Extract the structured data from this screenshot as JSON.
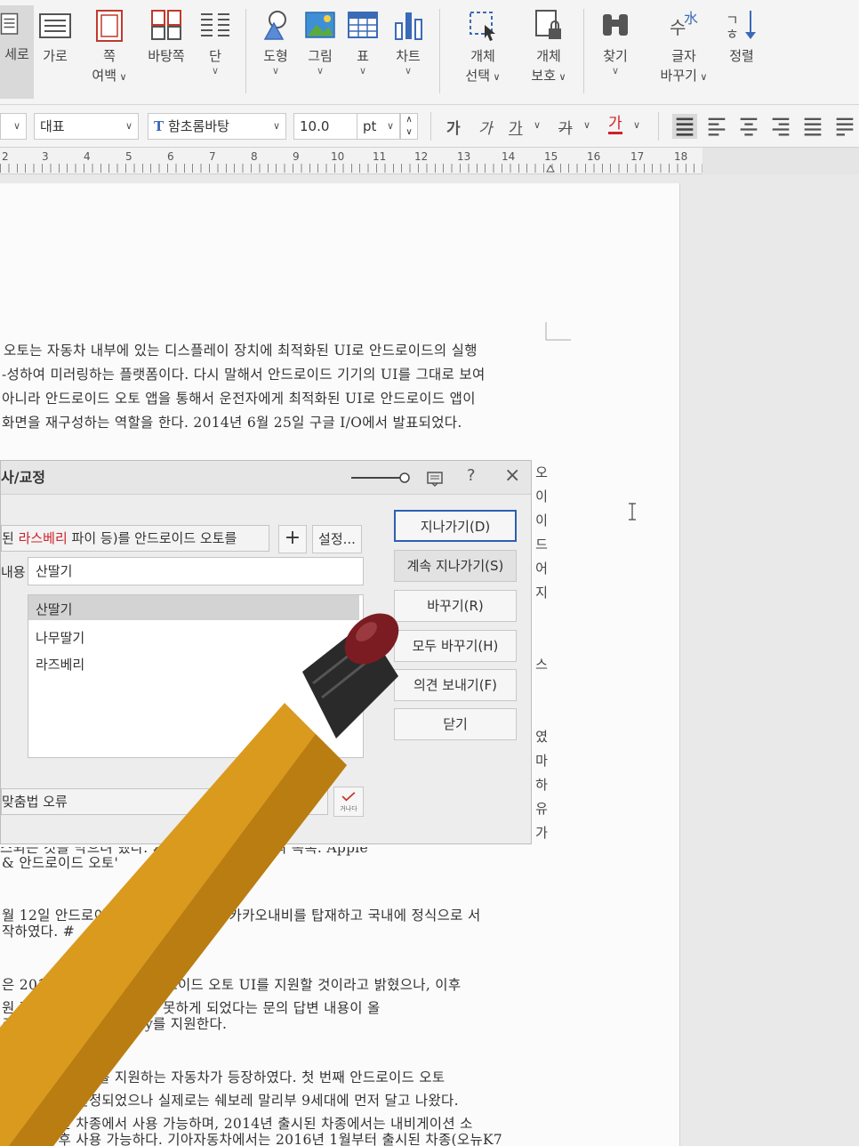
{
  "ribbon": {
    "items": [
      {
        "label": "세로",
        "icon": "page-portrait-icon"
      },
      {
        "label": "가로",
        "icon": "page-landscape-icon"
      },
      {
        "label": "쪽",
        "label2": "여백",
        "icon": "page-margin-icon"
      },
      {
        "label": "바탕쪽",
        "icon": "master-page-icon"
      },
      {
        "label": "단",
        "icon": "columns-icon"
      },
      {
        "label": "도형",
        "icon": "shapes-icon"
      },
      {
        "label": "그림",
        "icon": "picture-icon"
      },
      {
        "label": "표",
        "icon": "table-icon"
      },
      {
        "label": "차트",
        "icon": "chart-icon"
      },
      {
        "label": "개체",
        "label2": "선택",
        "icon": "object-select-icon"
      },
      {
        "label": "개체",
        "label2": "보호",
        "icon": "object-protect-icon"
      },
      {
        "label": "찾기",
        "icon": "find-binoculars-icon"
      },
      {
        "label": "글자",
        "label2": "바꾸기",
        "icon": "char-convert-icon"
      },
      {
        "label": "정렬",
        "icon": "sort-icon"
      }
    ]
  },
  "format_bar": {
    "style": "대표",
    "font": "함초롬바탕",
    "font_icon": "truetype-icon",
    "size": "10.0",
    "unit": "pt",
    "char_buttons": [
      "가",
      "가",
      "가",
      "가",
      "가"
    ],
    "font_color": "#d0202a"
  },
  "ruler": {
    "numbers": [
      "2",
      "3",
      "4",
      "5",
      "6",
      "7",
      "8",
      "9",
      "10",
      "11",
      "12",
      "13",
      "14",
      "15",
      "16",
      "17",
      "18"
    ]
  },
  "document": {
    "para1": [
      "오토는 자동차 내부에 있는 디스플레이 장치에 최적화된 UI로 안드로이드의 실행",
      "-성하여 미러링하는 플랫폼이다. 다시 말해서 안드로이드 기기의 UI를 그대로 보여",
      "아니라 안드로이드 오토 앱을 통해서 운전자에게 최적화된 UI로 안드로이드 앱이",
      "화면을 재구성하는 역할을 한다. 2014년 6월 25일 구글 I/O에서 발표되었다."
    ],
    "right_column": [
      "오",
      "이",
      "이",
      "드",
      "어",
      "지",
      "",
      "",
      "스",
      "",
      "",
      "였",
      "마",
      "하",
      "유",
      "가"
    ],
    "para2": [
      "스되는 것을 막으려 했다. 지원하는 내비게이션의 목록. Apple",
      "& 안드로이드 오토'",
      "",
      "월 12일 안드로이드 오토 기본 앱으로 카카오내비를 탑재하고 국내에 정식으로 서",
      "작하였다. #",
      "",
      "은 2019년 T MAP에 안드로이드 오토 UI를 지원할 것이라고 밝혔으나, 이후",
      " 원 정책으로 인해 출시하지 못하게 되었다는 문의 답변 내용이 올",
      "크 이미 Apple CarPlay를 지원한다.",
      "",
      "안드로이드 오토를 지원하는 자동차가 등장하였다. 첫 번째 안드로이드 오토",
      "대 소나타로 결정되었으나 실제로는 쉐보레 말리부 9세대에 먼저 달고 나왔다.",
      "한국 출시된 차종에서 사용 가능하며, 2014년 출시된 차종에서는 내비게이션 소",
      "업데이트 후 사용 가능하다. 기아자동차에서는 2016년 1월부터 출시된 차종(오뉴K7"
    ]
  },
  "dialog": {
    "title": "사/교정",
    "sentence_prefix": "된 ",
    "sentence_highlight": "라스베리",
    "sentence_suffix": " 파이 등)를 안드로이드 오토를",
    "add_button": "+",
    "settings_button": "설정...",
    "replace_label": "내용",
    "replace_value": "산딸기",
    "suggestions": [
      "산딸기",
      "나무딸기",
      "라즈베리"
    ],
    "error_label": "맞춤법 오류",
    "check_label": "거나다",
    "help": "?",
    "close": "×",
    "actions": {
      "skip": "지나가기(D)",
      "skip_all": "계속 지나가기(S)",
      "replace": "바꾸기(R)",
      "replace_all": "모두 바꾸기(H)",
      "feedback": "의견 보내기(F)",
      "close": "닫기"
    }
  }
}
